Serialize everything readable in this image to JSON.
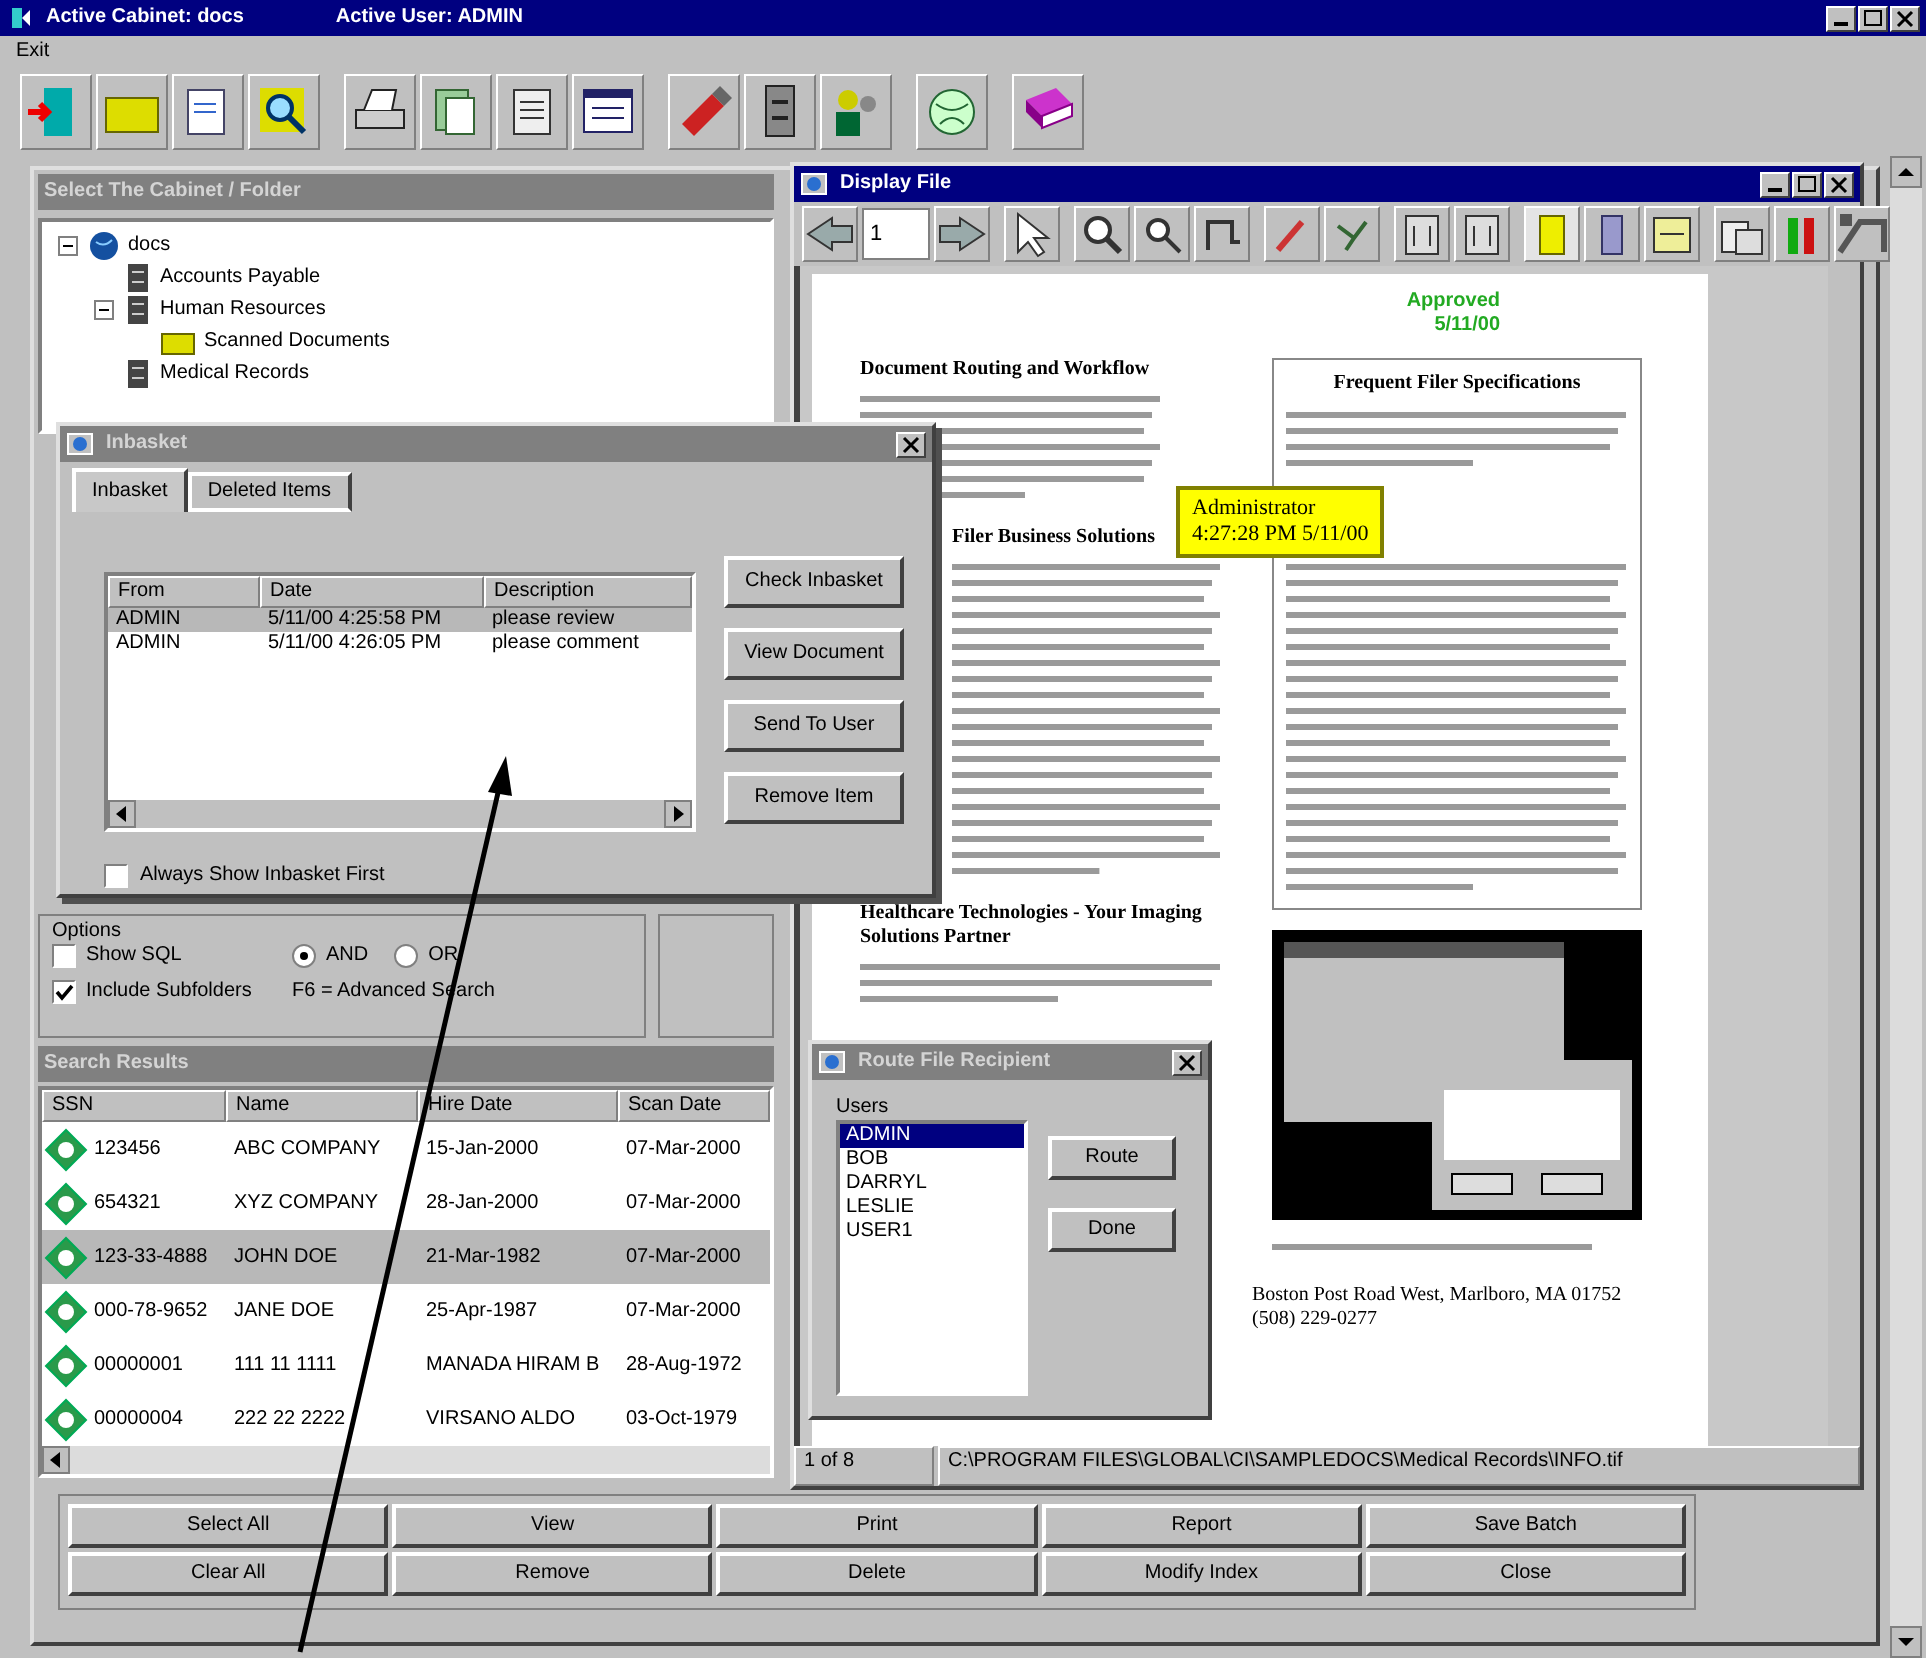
{
  "window": {
    "cabinet_label": "Active Cabinet: docs",
    "user_label": "Active User: ADMIN"
  },
  "menu": [
    {
      "label": "Exit"
    }
  ],
  "cabinet_panel": {
    "title": "Select The Cabinet / Folder",
    "tree": [
      {
        "label": "docs",
        "kind": "cabinet",
        "expanded": true,
        "children": [
          {
            "label": "Accounts Payable",
            "kind": "drawer"
          },
          {
            "label": "Human Resources",
            "kind": "drawer",
            "expanded": true,
            "children": [
              {
                "label": "Scanned Documents",
                "kind": "folder"
              }
            ]
          },
          {
            "label": "Medical Records",
            "kind": "drawer"
          }
        ]
      }
    ]
  },
  "options": {
    "title": "Options",
    "checkboxes": [
      {
        "label": "Show SQL",
        "checked": false
      },
      {
        "label": "Include Subfolders",
        "checked": true
      }
    ],
    "radios": [
      {
        "label": "AND",
        "selected": true
      },
      {
        "label": "OR",
        "selected": false
      }
    ],
    "hint": "F6 = Advanced Search"
  },
  "results": {
    "title": "Search Results",
    "columns": [
      "SSN",
      "Name",
      "Hire Date",
      "Scan Date"
    ],
    "rows": [
      {
        "cells": [
          "123456",
          "ABC COMPANY",
          "15-Jan-2000",
          "07-Mar-2000"
        ],
        "selected": false
      },
      {
        "cells": [
          "654321",
          "XYZ COMPANY",
          "28-Jan-2000",
          "07-Mar-2000"
        ],
        "selected": false
      },
      {
        "cells": [
          "123-33-4888",
          "JOHN DOE",
          "21-Mar-1982",
          "07-Mar-2000"
        ],
        "selected": true
      },
      {
        "cells": [
          "000-78-9652",
          "JANE DOE",
          "25-Apr-1987",
          "07-Mar-2000"
        ],
        "selected": false
      },
      {
        "cells": [
          "00000001",
          "111 11 1111",
          "MANADA HIRAM B",
          "28-Aug-1972"
        ],
        "selected": false
      },
      {
        "cells": [
          "00000004",
          "222 22 2222",
          "VIRSANO ALDO",
          "03-Oct-1979"
        ],
        "selected": false
      }
    ]
  },
  "buttons": [
    [
      "Select All",
      "View",
      "Print",
      "Report",
      "Save Batch"
    ],
    [
      "Clear All",
      "Remove",
      "Delete",
      "Modify Index",
      "Close"
    ]
  ],
  "display_file": {
    "title": "Display File",
    "page": "1",
    "document": {
      "stamp": [
        "Approved",
        "5/11/00"
      ],
      "sections": [
        {
          "heading": "Document Routing and Workflow"
        },
        {
          "heading": "Filer Business Solutions"
        },
        {
          "heading": "Healthcare Technologies - Your Imaging Solutions Partner"
        }
      ],
      "sidebar_title": "Frequent Filer Specifications",
      "footer": [
        "Boston Post Road West, Marlboro, MA 01752",
        "(508) 229-0277"
      ]
    },
    "note": {
      "author": "Administrator",
      "time": "4:27:28 PM 5/11/00"
    },
    "status": [
      "1 of 8",
      "C:\\PROGRAM FILES\\GLOBAL\\CI\\SAMPLEDOCS\\Medical Records\\INFO.tif"
    ]
  },
  "inbasket": {
    "title": "Inbasket",
    "tabs": [
      {
        "label": "Inbasket",
        "selected": true
      },
      {
        "label": "Deleted Items",
        "selected": false
      }
    ],
    "columns": [
      "From",
      "Date",
      "Description"
    ],
    "rows": [
      {
        "cells": [
          "ADMIN",
          "5/11/00 4:25:58 PM",
          "please review"
        ],
        "selected": true
      },
      {
        "cells": [
          "ADMIN",
          "5/11/00 4:26:05 PM",
          "please comment"
        ],
        "selected": false
      }
    ],
    "buttons": [
      "Check Inbasket",
      "View Document",
      "Send To User",
      "Remove Item"
    ],
    "checkbox": {
      "label": "Always Show Inbasket First",
      "checked": false
    }
  },
  "route_dialog": {
    "title": "Route File Recipient",
    "list_label": "Users",
    "users": [
      {
        "label": "ADMIN",
        "selected": true
      },
      {
        "label": "BOB",
        "selected": false
      },
      {
        "label": "DARRYL",
        "selected": false
      },
      {
        "label": "LESLIE",
        "selected": false
      },
      {
        "label": "USER1",
        "selected": false
      }
    ],
    "buttons": [
      "Route",
      "Done"
    ]
  }
}
